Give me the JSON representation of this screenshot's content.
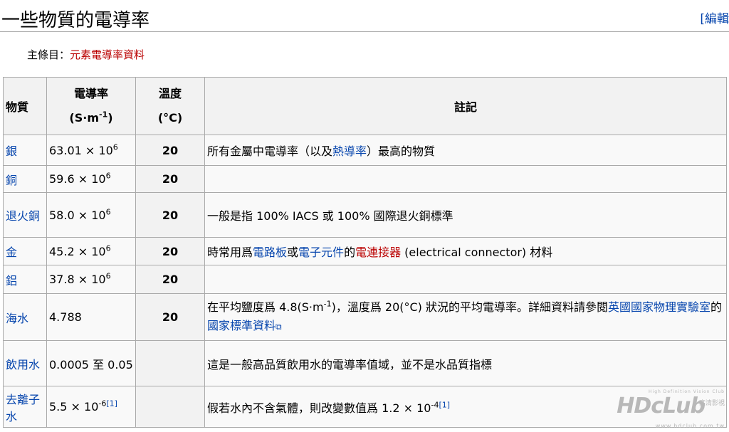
{
  "heading": {
    "title": "一些物質的電導率",
    "edit": "[編輯"
  },
  "hatnote": {
    "prefix": "主條目：",
    "link": "元素電導率資料"
  },
  "table": {
    "headers": {
      "material": "物質",
      "conductivity": "電導率",
      "conductivity_unit_base": "(S·m",
      "conductivity_unit_exp": "-1",
      "conductivity_unit_close": ")",
      "temperature": "溫度",
      "temperature_unit": "(°C)",
      "notes": "註記"
    },
    "rows": [
      {
        "material": "銀",
        "value_base": "63.01 × 10",
        "value_exp": "6",
        "temp": "20",
        "note_pre": "所有金屬中電導率（以及",
        "note_link": "熱導率",
        "note_post": "）最高的物質"
      },
      {
        "material": "銅",
        "value_base": "59.6 × 10",
        "value_exp": "6",
        "temp": "20"
      },
      {
        "material": "退火銅",
        "value_base": "58.0 × 10",
        "value_exp": "6",
        "temp": "20",
        "note": "一般是指 100% IACS 或 100% 國際退火銅標準"
      },
      {
        "material": "金",
        "value_base": "45.2 × 10",
        "value_exp": "6",
        "temp": "20",
        "note_pre": "時常用爲",
        "link1": "電路板",
        "note_mid1": "或",
        "link2": "電子元件",
        "note_mid2": "的",
        "link3": "電連接器",
        "note_post": " (electrical connector) 材料"
      },
      {
        "material": "鋁",
        "value_base": "37.8 × 10",
        "value_exp": "6",
        "temp": "20"
      },
      {
        "material": "海水",
        "value": "4.788",
        "temp": "20",
        "note_pre": "在平均鹽度爲 4.8(S·m",
        "note_exp": "-1",
        "note_mid": ")，溫度爲 20(°C) 狀況的平均電導率。詳細資料請參閱",
        "link1": "英國國家物理實驗室",
        "note_mid2": "的 ",
        "link2": "國家標準資料",
        "ext_icon": "⧉"
      },
      {
        "material": "飲用水",
        "value": "0.0005 至 0.05",
        "note": "這是一般高品質飲用水的電導率值域，並不是水品質指標"
      },
      {
        "material": "去離子水",
        "value_base": "5.5 × 10",
        "value_exp": "-6",
        "ref": "[1]",
        "note_pre": "假若水內不含氣體，則改變數值爲 1.2 × 10",
        "note_exp": "-4",
        "note_ref": "[1]"
      }
    ]
  },
  "watermark": {
    "tagline": "High Definition Vision Club",
    "logo": "HDcLub",
    "cn": "高清影視",
    "url": "www.hdclub.com.tw"
  }
}
